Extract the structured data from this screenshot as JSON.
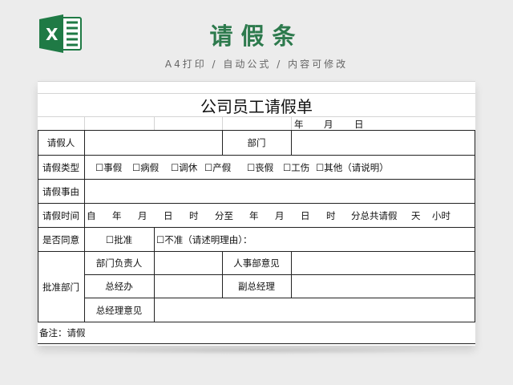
{
  "header": {
    "title": "请假条",
    "subtitle": "A4打印 / 自动公式 / 内容可修改",
    "logo_icon": "excel-icon"
  },
  "form": {
    "title": "公司员工请假单",
    "date_row": {
      "year": "年",
      "month": "月",
      "day": "日"
    },
    "applicant_label": "请假人",
    "dept_label": "部门",
    "leave_type_label": "请假类型",
    "leave_types": [
      "☐事假",
      "☐病假",
      "☐调休",
      "☐产假",
      "☐丧假",
      "☐工伤",
      "☐其他（请说明）"
    ],
    "reason_label": "请假事由",
    "time_label": "请假时间",
    "time_parts": {
      "from": "自",
      "y1": "年",
      "m1": "月",
      "d1": "日",
      "h1": "时",
      "to": "分至",
      "y2": "年",
      "m2": "月",
      "d2": "日",
      "h2": "时",
      "total": "分总共请假",
      "days": "天",
      "hours": "小时"
    },
    "agree_label": "是否同意",
    "approve_option": "☐批准",
    "reject_option": "☐不准（请述明理由）：",
    "approval_dept_label": "批准部门",
    "dept_head_label": "部门负责人",
    "hr_label": "人事部意见",
    "gm_label": "总经办",
    "deputy_gm_label": "副总经理",
    "gm_opinion_label": "总经理意见",
    "note": "备注：请假"
  },
  "colors": {
    "accent": "#2d7a4d",
    "excel_green": "#1f7a45"
  }
}
